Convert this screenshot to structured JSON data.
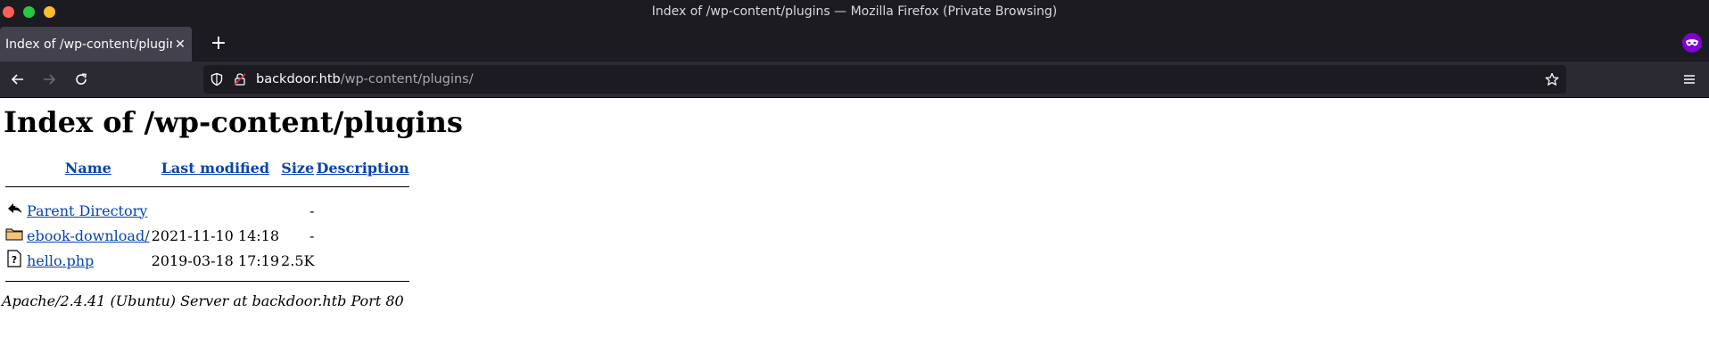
{
  "window": {
    "title": "Index of /wp-content/plugins — Mozilla Firefox (Private Browsing)"
  },
  "tab": {
    "title": "Index of /wp-content/plugins",
    "close_glyph": "✕",
    "new_tab_glyph": "+"
  },
  "urlbar": {
    "host": "backdoor.htb",
    "path": "/wp-content/plugins/"
  },
  "page": {
    "heading": "Index of /wp-content/plugins",
    "columns": {
      "name": "Name",
      "last_modified": "Last modified",
      "size": "Size",
      "description": "Description"
    },
    "rows": [
      {
        "icon": "back-icon",
        "name": "Parent Directory",
        "modified": "",
        "size": "-",
        "description": ""
      },
      {
        "icon": "folder-icon",
        "name": "ebook-download/",
        "modified": "2021-11-10 14:18",
        "size": "-",
        "description": ""
      },
      {
        "icon": "unknown-file-icon",
        "name": "hello.php",
        "modified": "2019-03-18 17:19",
        "size": "2.5K",
        "description": ""
      }
    ],
    "footer": "Apache/2.4.41 (Ubuntu) Server at backdoor.htb Port 80"
  },
  "colors": {
    "chrome_dark": "#1c1b22",
    "toolbar": "#2b2a33",
    "active_tab": "#42414d",
    "link": "#1a5fb4",
    "private_purple": "#8000d7"
  }
}
